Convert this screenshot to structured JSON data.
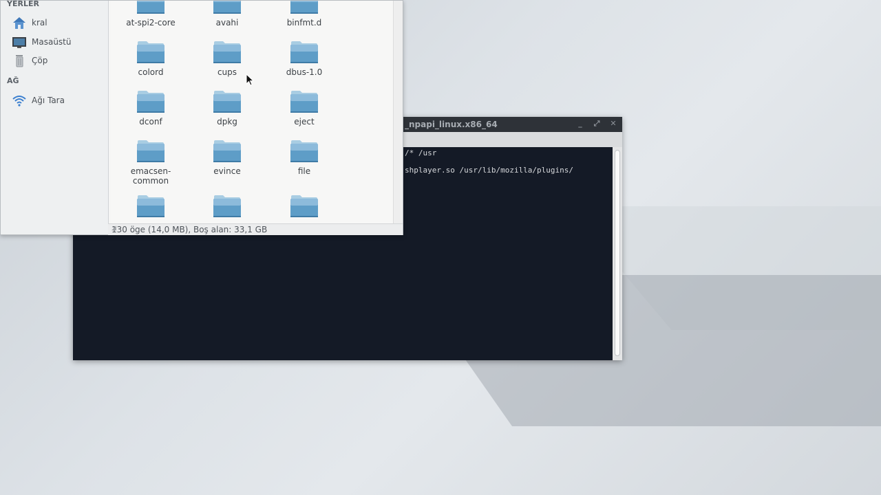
{
  "terminal": {
    "title": "_npapi_linux.x86_64",
    "lines": [
      "/* /usr",
      "shplayer.so /usr/lib/mozilla/plugins/"
    ],
    "buttons": {
      "minimize": "_",
      "maximize": "⤢",
      "close": "✕"
    }
  },
  "filemanager": {
    "sidebar": {
      "places_header": "YERLER",
      "places": [
        {
          "label": "kral",
          "icon": "home-icon"
        },
        {
          "label": "Masaüstü",
          "icon": "desktop-icon"
        },
        {
          "label": "Çöp",
          "icon": "trash-icon"
        }
      ],
      "network_header": "AĞ",
      "network": [
        {
          "label": "Ağı Tara",
          "icon": "wifi-icon"
        }
      ]
    },
    "folders": [
      "at-spi2-core",
      "avahi",
      "binfmt.d",
      "colord",
      "cups",
      "dbus-1.0",
      "dconf",
      "dpkg",
      "eject",
      "emacsen-common",
      "evince",
      "file",
      "",
      "",
      ""
    ],
    "status": "130 öge (14,0 MB), Boş alan: 33,1 GB"
  },
  "colors": {
    "folder_top": "#a9cde3",
    "folder_body": "#5e9dc7",
    "terminal_bg": "#141a26"
  }
}
